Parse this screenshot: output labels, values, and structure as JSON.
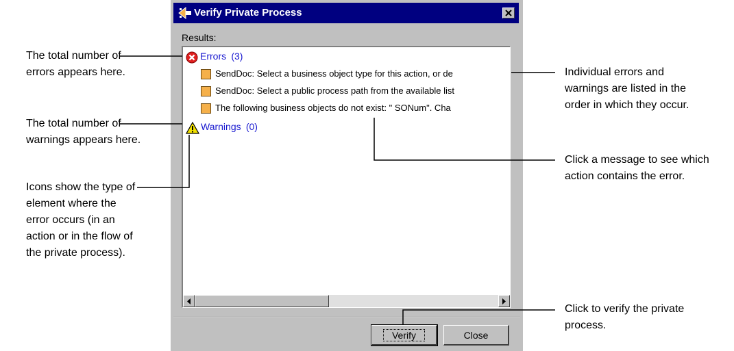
{
  "dialog": {
    "title": "Verify Private Process",
    "results_label": "Results:",
    "errors_label": "Errors",
    "errors_count": "(3)",
    "warnings_label": "Warnings",
    "warnings_count": "(0)",
    "messages": [
      "SendDoc: Select a business  object type for this action, or de",
      "SendDoc: Select a public process path from the available list",
      "The following business objects do not exist: \"  SONum\".  Cha"
    ],
    "verify_label": "Verify",
    "close_label": "Close"
  },
  "callouts": {
    "errors_total": [
      "The total number of",
      "errors appears here."
    ],
    "warnings_total": [
      "The total number of",
      "warnings appears here."
    ],
    "icons_type": [
      "Icons show the type of",
      "element where the",
      "error occurs (in an",
      "action or in the flow of",
      "the private process)."
    ],
    "individual": [
      "Individual errors and",
      "warnings are listed in the",
      "order in which they occur."
    ],
    "click_message": [
      "Click a message to see which",
      "action contains the error."
    ],
    "click_verify": [
      "Click to verify the private",
      "process."
    ]
  },
  "colors": {
    "title_bar": "#000080",
    "dialog_bg": "#c0c0c0",
    "group_link": "#1818d0",
    "message_icon": "#f5b04a",
    "error_icon": "#e02020",
    "warning_icon": "#f0e000"
  }
}
